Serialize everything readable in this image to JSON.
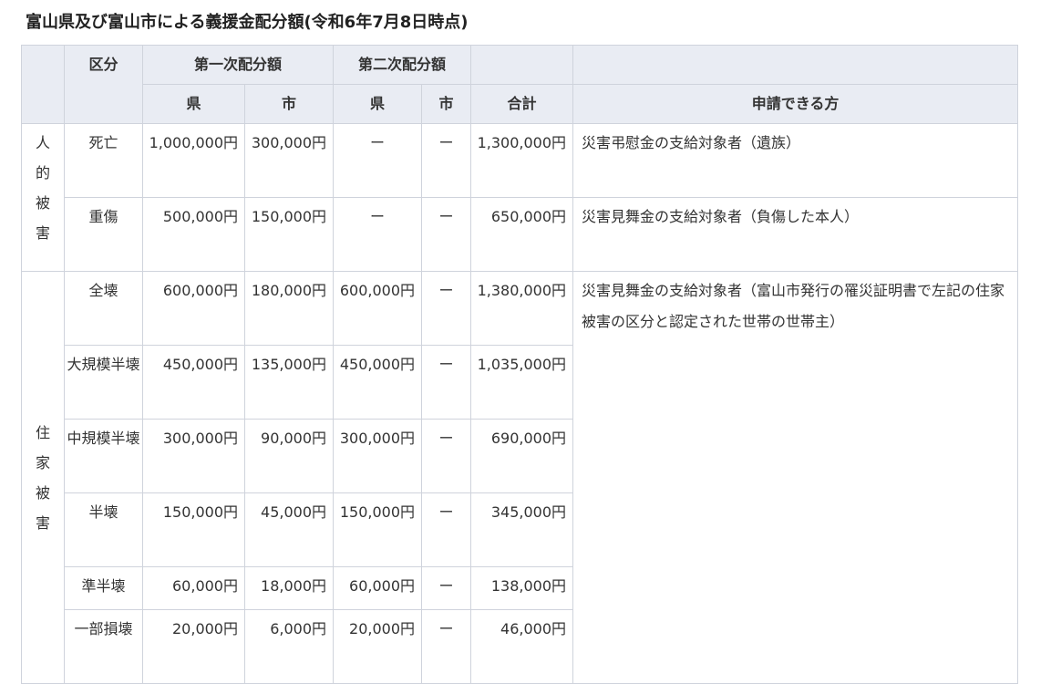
{
  "title": "富山県及び富山市による義援金配分額(令和6年7月8日時点)",
  "headers": {
    "division": "区分",
    "first": "第一次配分額",
    "second": "第二次配分額",
    "pref": "県",
    "city": "市",
    "pref2": "県",
    "city2": "市",
    "total": "合計",
    "applicant": "申請できる方"
  },
  "groups": {
    "human": "人的被害",
    "house": "住家被害"
  },
  "rows": [
    {
      "cat": "死亡",
      "p1": "1,000,000円",
      "c1": "300,000円",
      "p2": "ー",
      "c2": "ー",
      "total": "1,300,000円",
      "desc": "災害弔慰金の支給対象者（遺族）"
    },
    {
      "cat": "重傷",
      "p1": "500,000円",
      "c1": "150,000円",
      "p2": "ー",
      "c2": "ー",
      "total": "650,000円",
      "desc": "災害見舞金の支給対象者（負傷した本人）"
    },
    {
      "cat": "全壊",
      "p1": "600,000円",
      "c1": "180,000円",
      "p2": "600,000円",
      "c2": "ー",
      "total": "1,380,000円",
      "desc": "災害見舞金の支給対象者（富山市発行の罹災証明書で左記の住家被害の区分と認定された世帯の世帯主）"
    },
    {
      "cat": "大規模半壊",
      "p1": "450,000円",
      "c1": "135,000円",
      "p2": "450,000円",
      "c2": "ー",
      "total": "1,035,000円"
    },
    {
      "cat": "中規模半壊",
      "p1": "300,000円",
      "c1": "90,000円",
      "p2": "300,000円",
      "c2": "ー",
      "total": "690,000円"
    },
    {
      "cat": "半壊",
      "p1": "150,000円",
      "c1": "45,000円",
      "p2": "150,000円",
      "c2": "ー",
      "total": "345,000円"
    },
    {
      "cat": "準半壊",
      "p1": "60,000円",
      "c1": "18,000円",
      "p2": "60,000円",
      "c2": "ー",
      "total": "138,000円"
    },
    {
      "cat": "一部損壊",
      "p1": "20,000円",
      "c1": "6,000円",
      "p2": "20,000円",
      "c2": "ー",
      "total": "46,000円"
    }
  ]
}
